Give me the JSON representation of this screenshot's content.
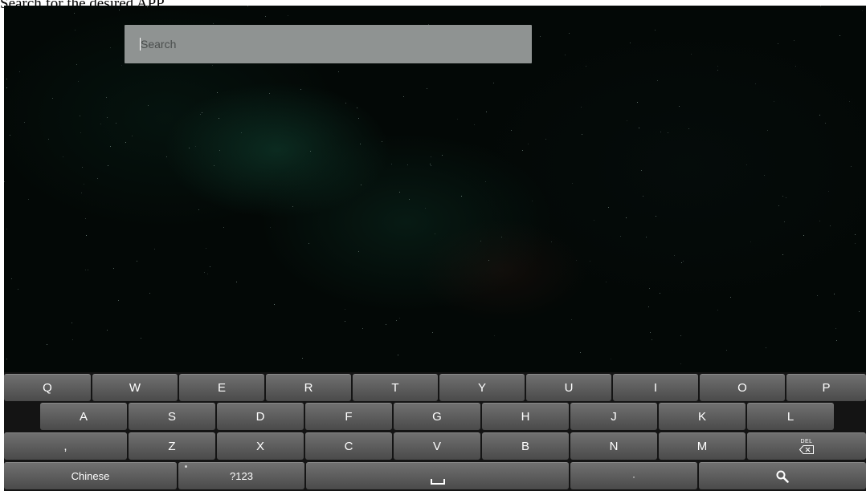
{
  "caption": "Search for the desired APP.",
  "search": {
    "placeholder": "Search"
  },
  "keyboard": {
    "row1": [
      "Q",
      "W",
      "E",
      "R",
      "T",
      "Y",
      "U",
      "I",
      "O",
      "P"
    ],
    "row2": [
      "A",
      "S",
      "D",
      "F",
      "G",
      "H",
      "J",
      "K",
      "L"
    ],
    "row3": [
      ",",
      "Z",
      "X",
      "C",
      "V",
      "B",
      "N",
      "M"
    ],
    "del_label": "DEL",
    "chinese_label": "Chinese",
    "symbols_label": "?123",
    "period_label": "·",
    "space_icon": "space-bar-icon",
    "search_icon": "search-icon"
  }
}
